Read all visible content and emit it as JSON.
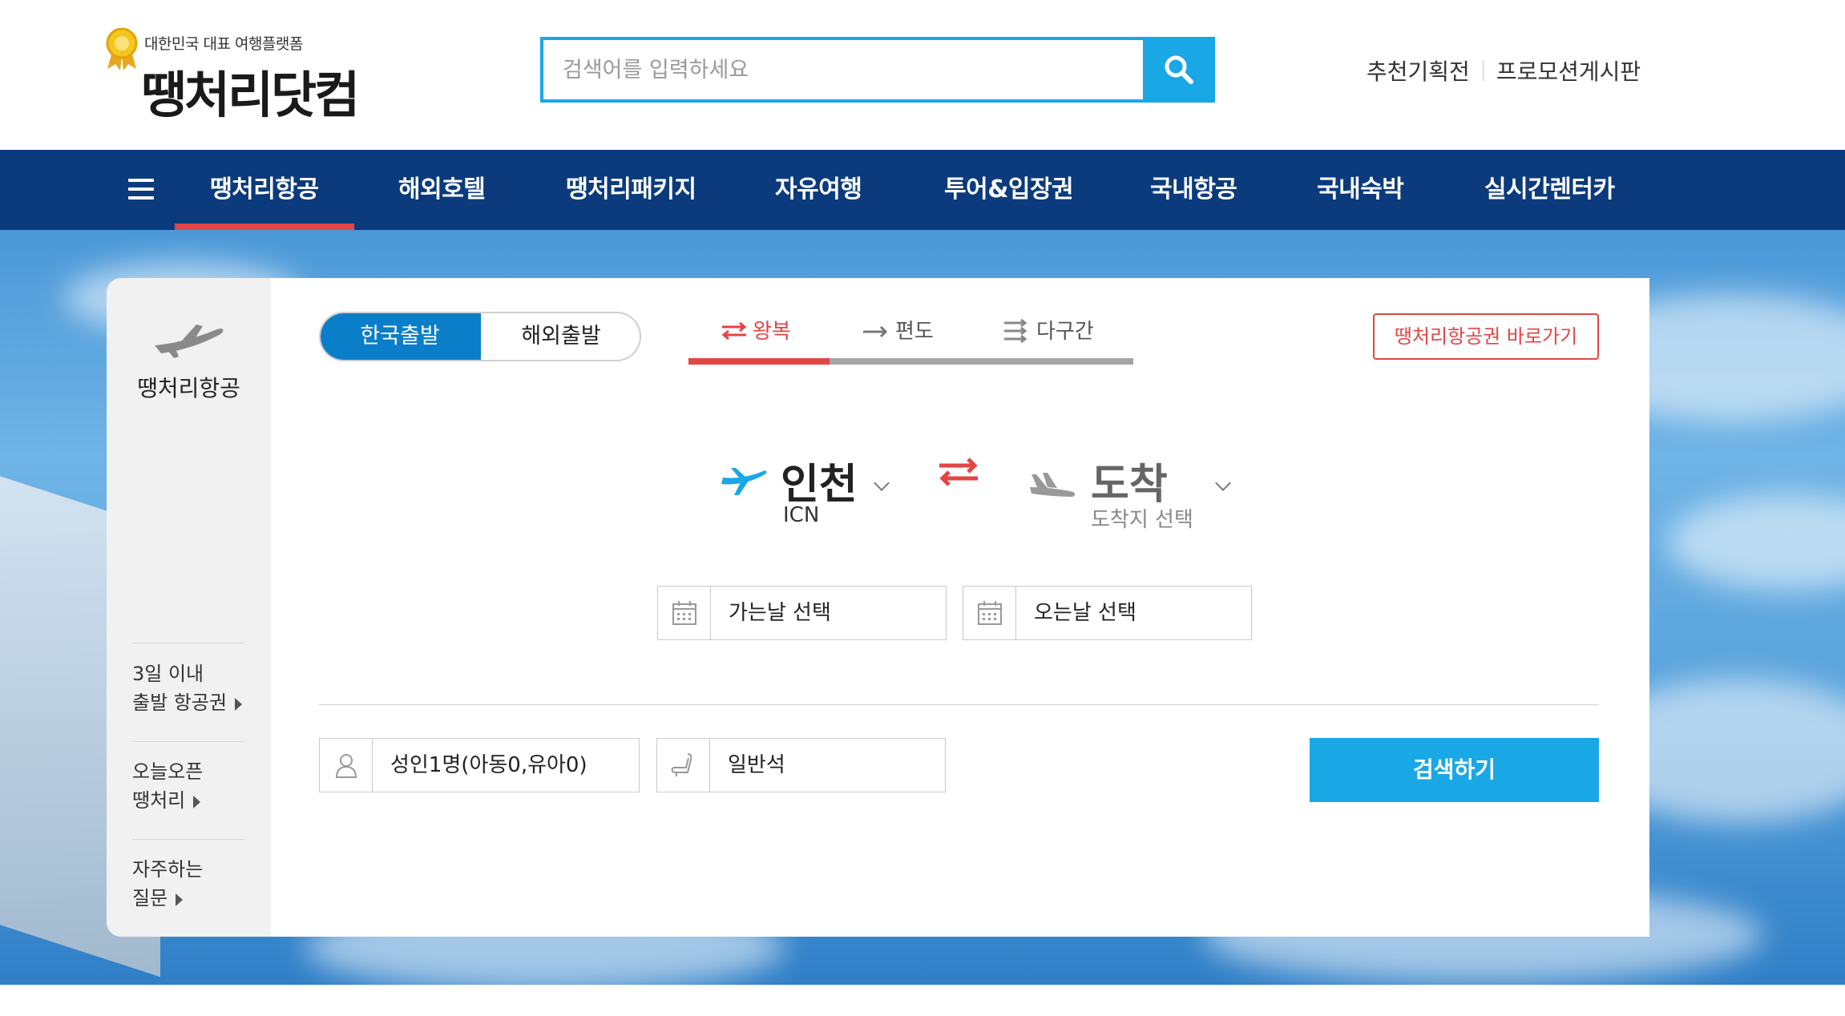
{
  "header": {
    "tagline": "대한민국 대표 여행플랫폼",
    "brand": "땡처리닷컴",
    "search_placeholder": "검색어를 입력하세요",
    "util_links": [
      "추천기획전",
      "프로모션게시판"
    ]
  },
  "nav": {
    "items": [
      "땡처리항공",
      "해외호텔",
      "땡처리패키지",
      "자유여행",
      "투어&입장권",
      "국내항공",
      "국내숙박",
      "실시간렌터카"
    ],
    "active": "땡처리항공"
  },
  "side": {
    "title": "땡처리항공",
    "links": [
      {
        "line1": "3일 이내",
        "line2": "출발 항공권"
      },
      {
        "line1": "오늘오픈",
        "line2": "땡처리"
      },
      {
        "line1": "자주하는",
        "line2": "질문"
      }
    ]
  },
  "booking": {
    "origin_toggle": [
      "한국출발",
      "해외출발"
    ],
    "trip_types": [
      "왕복",
      "편도",
      "다구간"
    ],
    "active_trip": "왕복",
    "shortcut": "땡처리항공권 바로가기",
    "departure": {
      "city": "인천",
      "code": "ICN"
    },
    "arrival": {
      "city": "도착",
      "code": "도착지 선택"
    },
    "depart_date": "가는날 선택",
    "return_date": "오는날 선택",
    "passengers": "성인1명(아동0,유아0)",
    "cabin": "일반석",
    "search_button": "검색하기"
  },
  "colors": {
    "nav_bg": "#0b3b7c",
    "accent_blue": "#1aa7e6",
    "accent_red": "#e34545",
    "toggle_blue": "#0b7ec9"
  },
  "icons": [
    "medal-icon",
    "search-icon",
    "menu-icon",
    "plane-icon",
    "swap-icon",
    "arrow-right-icon",
    "multi-city-icon",
    "chevron-down-icon",
    "calendar-icon",
    "person-icon",
    "seat-icon",
    "caret-right-icon"
  ]
}
